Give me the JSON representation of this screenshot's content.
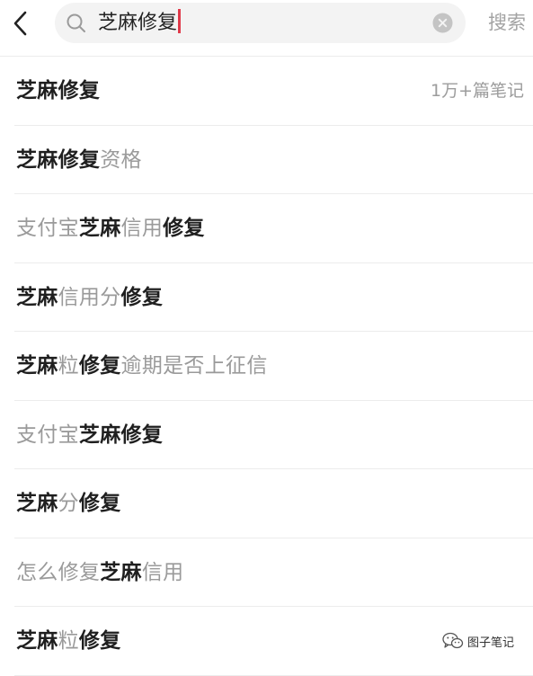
{
  "search": {
    "query": "芝麻修复",
    "action_label": "搜索"
  },
  "suggestions": [
    {
      "segments": [
        {
          "text": "芝麻修复",
          "highlight": true
        }
      ],
      "meta": "1万+篇笔记"
    },
    {
      "segments": [
        {
          "text": "芝麻修复",
          "highlight": true
        },
        {
          "text": "资格",
          "highlight": false
        }
      ]
    },
    {
      "segments": [
        {
          "text": "支付宝",
          "highlight": false
        },
        {
          "text": "芝麻",
          "highlight": true
        },
        {
          "text": "信用",
          "highlight": false
        },
        {
          "text": "修复",
          "highlight": true
        }
      ]
    },
    {
      "segments": [
        {
          "text": "芝麻",
          "highlight": true
        },
        {
          "text": "信用分",
          "highlight": false
        },
        {
          "text": "修复",
          "highlight": true
        }
      ]
    },
    {
      "segments": [
        {
          "text": "芝麻",
          "highlight": true
        },
        {
          "text": "粒",
          "highlight": false
        },
        {
          "text": "修复",
          "highlight": true
        },
        {
          "text": "逾期是否上征信",
          "highlight": false
        }
      ]
    },
    {
      "segments": [
        {
          "text": "支付宝",
          "highlight": false
        },
        {
          "text": "芝麻修复",
          "highlight": true
        }
      ]
    },
    {
      "segments": [
        {
          "text": "芝麻",
          "highlight": true
        },
        {
          "text": "分",
          "highlight": false
        },
        {
          "text": "修复",
          "highlight": true
        }
      ]
    },
    {
      "segments": [
        {
          "text": "怎么修复",
          "highlight": false
        },
        {
          "text": "芝麻",
          "highlight": true
        },
        {
          "text": "信用",
          "highlight": false
        }
      ]
    },
    {
      "segments": [
        {
          "text": "芝麻",
          "highlight": true
        },
        {
          "text": "粒",
          "highlight": false
        },
        {
          "text": "修复",
          "highlight": true
        }
      ]
    }
  ],
  "watermark": {
    "label": "图子笔记",
    "icon": "wechat-icon"
  },
  "colors": {
    "highlight_text": "#1f1f1f",
    "normal_text": "#9a9a9a",
    "cursor": "#e03a4a",
    "search_bg": "#f3f3f3",
    "divider": "#ececec"
  }
}
